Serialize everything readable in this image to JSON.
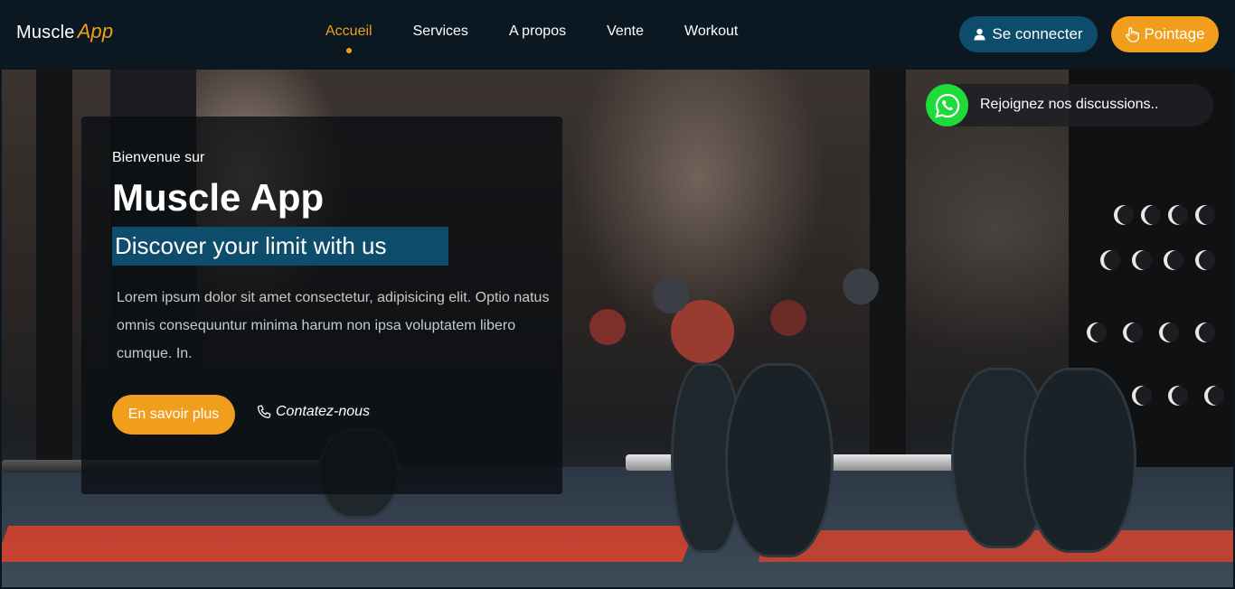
{
  "header": {
    "brand_main": "Muscle",
    "brand_accent": "App",
    "nav": [
      "Accueil",
      "Services",
      "A propos",
      "Vente",
      "Workout"
    ],
    "active_nav": "Accueil",
    "login_label": "Se connecter",
    "pointage_label": "Pointage"
  },
  "hero": {
    "welcome": "Bienvenue sur",
    "title": "Muscle App",
    "tagline": "Discover your limit with us",
    "description": "Lorem ipsum dolor sit amet consectetur, adipisicing elit. Optio natus omnis consequuntur minima harum non ipsa voluptatem libero cumque. In.",
    "cta_label": "En savoir plus",
    "contact_label": "Contatez-nous"
  },
  "whatsapp": {
    "label": "Rejoignez nos discussions.."
  },
  "colors": {
    "accent": "#f09e1c",
    "primary": "#0d4d6b",
    "header_bg": "#0b1822",
    "whatsapp": "#1edb39"
  }
}
